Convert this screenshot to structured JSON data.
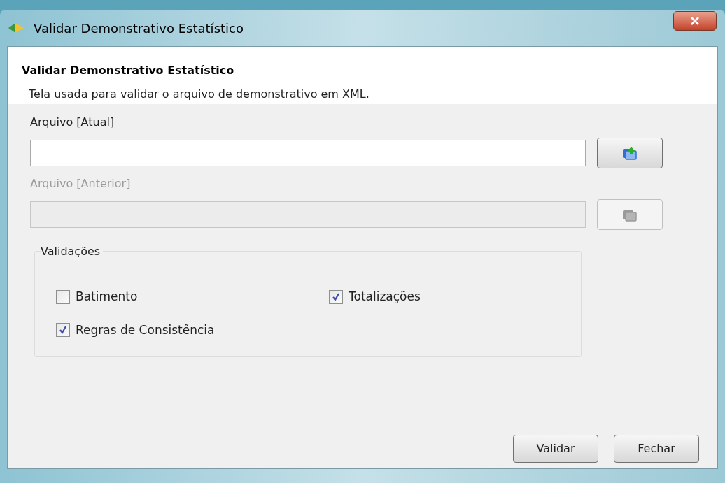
{
  "window": {
    "title": "Validar Demonstrativo Estatístico"
  },
  "header": {
    "title": "Validar Demonstrativo Estatístico",
    "description": "Tela usada para validar o arquivo de demonstrativo em XML."
  },
  "files": [
    {
      "label": "Arquivo [Atual]",
      "disabled": false
    },
    {
      "label": "Arquivo [Anterior]",
      "disabled": true
    }
  ],
  "validations": {
    "title": "Validações",
    "options": [
      {
        "label": "Batimento",
        "checked": false
      },
      {
        "label": "Totalizações",
        "checked": true
      },
      {
        "label": "Regras de Consistência",
        "checked": true
      }
    ]
  },
  "buttons": [
    "Validar",
    "Fechar"
  ]
}
